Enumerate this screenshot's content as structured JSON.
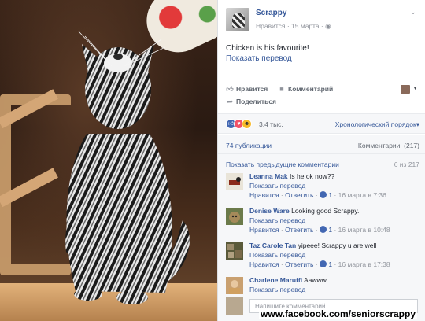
{
  "post": {
    "page_name": "Scrappy",
    "meta": "Нравится · 15 марта · ",
    "text": "Chicken is his favourite!",
    "translate": "Показать перевод"
  },
  "actions": {
    "like": "Нравится",
    "comment": "Комментарий",
    "share": "Поделиться"
  },
  "reactions": {
    "count": "3,4 тыс.",
    "order": "Хронологический порядок",
    "publications": "74 публикации",
    "comments_total": "Комментарии: (217)"
  },
  "comments": {
    "show_prev": "Показать предыдущие комментарии",
    "prev_count": "6 из 217",
    "items": [
      {
        "name": "Leanna Mak",
        "text": "Is he ok now??",
        "translate": "Показать перевод",
        "like": "Нравится",
        "reply": "Ответить",
        "likes": "1",
        "time": "16 марта в 7:36"
      },
      {
        "name": "Denise Ware",
        "text": "Looking good Scrappy.",
        "translate": "Показать перевод",
        "like": "Нравится",
        "reply": "Ответить",
        "likes": "1",
        "time": "16 марта в 10:48"
      },
      {
        "name": "Taz Carole Tan",
        "text": "yipeee! Scrappy u are well",
        "translate": "Показать перевод",
        "like": "Нравится",
        "reply": "Ответить",
        "likes": "1",
        "time": "16 марта в 17:38"
      },
      {
        "name": "Charlene Maruffi",
        "text": "Aawww",
        "translate": "Показать перевод"
      }
    ],
    "reply_placeholder": "Напишите комментарий..."
  },
  "watermark": "www.facebook.com/seniorscrappy",
  "icons": {
    "like": "thumbs-up-icon",
    "comment": "speech-bubble-icon",
    "share": "share-arrow-icon",
    "globe": "globe-icon",
    "chevron": "chevron-down-icon"
  },
  "colors": {
    "link": "#365899",
    "like_blue": "#4267b2",
    "love": "#f25268",
    "haha": "#f7b928"
  }
}
